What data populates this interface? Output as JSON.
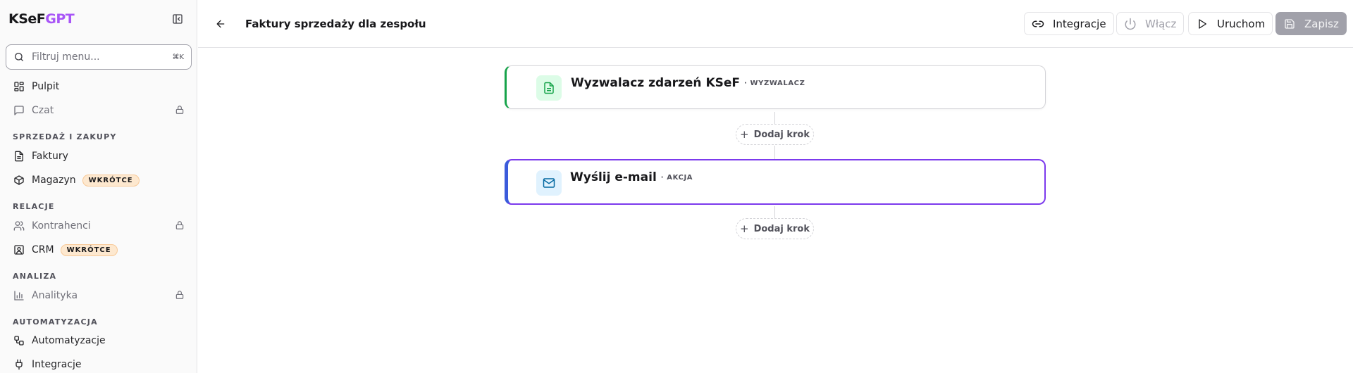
{
  "app": {
    "logo_part1": "KSeF",
    "logo_part2": "GPT"
  },
  "search": {
    "placeholder": "Filtruj menu...",
    "shortcut": "⌘K"
  },
  "sidebar": {
    "items": [
      {
        "label": "Pulpit",
        "icon": "dashboard-icon"
      },
      {
        "label": "Czat",
        "icon": "chat-icon",
        "locked": true
      },
      {
        "label": "Faktury",
        "icon": "document-icon"
      },
      {
        "label": "Magazyn",
        "icon": "package-icon",
        "badge": "WKRÓTCE"
      },
      {
        "label": "Kontrahenci",
        "icon": "users-icon",
        "locked": true
      },
      {
        "label": "CRM",
        "icon": "contact-card-icon",
        "badge": "WKRÓTCE"
      },
      {
        "label": "Analityka",
        "icon": "bar-chart-icon",
        "locked": true
      },
      {
        "label": "Automatyzacje",
        "icon": "workflow-icon"
      },
      {
        "label": "Integracje",
        "icon": "plug-icon"
      }
    ],
    "sections": {
      "sales": "SPRZEDAŻ I ZAKUPY",
      "relations": "RELACJE",
      "analysis": "ANALIZA",
      "automation": "AUTOMATYZACJA"
    }
  },
  "header": {
    "title": "Faktury sprzedaży dla zespołu",
    "buttons": {
      "integrations": "Integracje",
      "enable": "Włącz",
      "run": "Uruchom",
      "save": "Zapisz"
    }
  },
  "workflow": {
    "nodes": [
      {
        "title": "Wyzwalacz zdarzeń KSeF",
        "tag": "· WYZWALACZ",
        "icon": "file-text-icon",
        "accent": "#16a34a"
      },
      {
        "title": "Wyślij e-mail",
        "tag": "· AKCJA",
        "icon": "mail-icon",
        "accent": "#7c3aed"
      }
    ],
    "add_step_label": "Dodaj krok"
  },
  "colors": {
    "brand": "#a855f7",
    "trigger": "#16a34a",
    "action_border": "#7c3aed",
    "badge_bg": "#fde8cf"
  }
}
